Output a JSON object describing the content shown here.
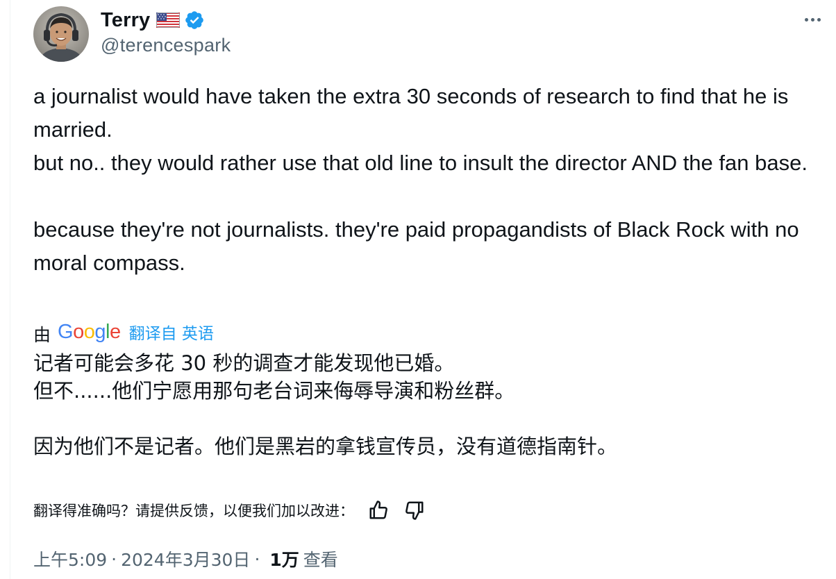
{
  "author": {
    "display_name": "Terry",
    "flag_icon": "us-flag-icon",
    "verified_icon": "verified-badge-icon",
    "handle": "@terencespark"
  },
  "menu_icon": "more-horizontal-icon",
  "tweet": {
    "text": "a journalist would have taken the extra 30 seconds of research to find that he is married.\nbut no.. they would rather use that old line to insult the director AND the fan base.\n\nbecause they're not journalists. they're paid propagandists of Black Rock with no moral compass."
  },
  "translation": {
    "by_label": "由",
    "provider": "Google",
    "link_label": "翻译自 英语",
    "text": "记者可能会多花 30 秒的调查才能发现他已婚。\n但不......他们宁愿用那句老台词来侮辱导演和粉丝群。\n\n因为他们不是记者。他们是黑岩的拿钱宣传员，没有道德指南针。",
    "feedback_prompt": "翻译得准确吗？请提供反馈，以便我们加以改进：",
    "thumbs_up_icon": "thumbs-up-icon",
    "thumbs_down_icon": "thumbs-down-icon"
  },
  "meta": {
    "time": "上午5:09",
    "dot1": "·",
    "date": "2024年3月30日",
    "dot2": "·",
    "views_count": "1万",
    "views_label": "查看"
  },
  "colors": {
    "text": "#0f1419",
    "secondary": "#536471",
    "link": "#1d9bf0",
    "verified": "#1d9bf0"
  }
}
